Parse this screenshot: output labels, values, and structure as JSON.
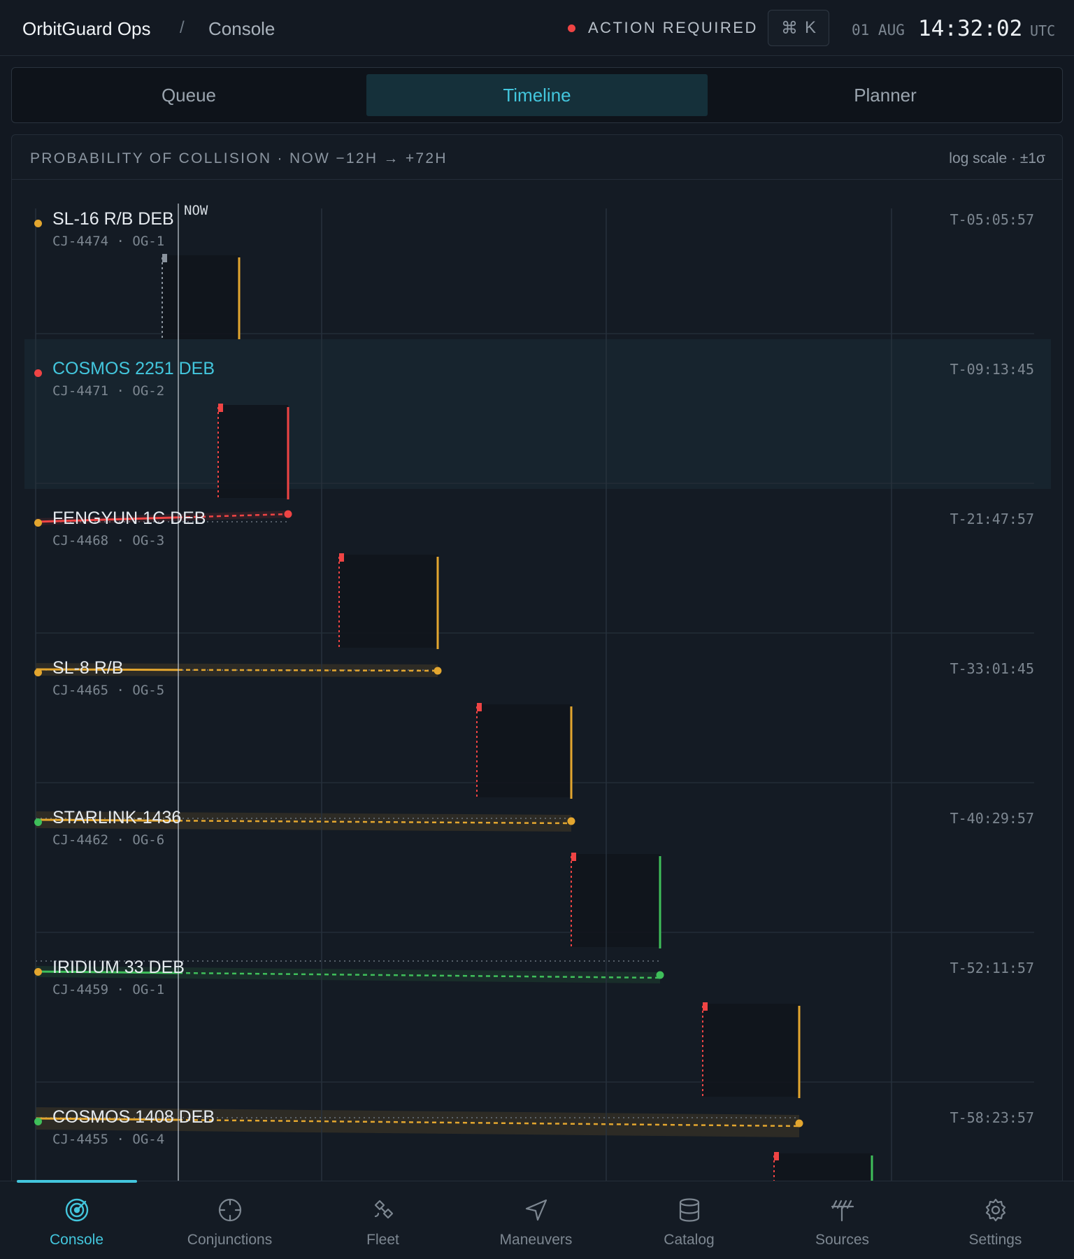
{
  "header": {
    "brand": "OrbitGuard Ops",
    "separator": "/",
    "breadcrumb": "Console",
    "alert_text": "ACTION REQUIRED",
    "shortcut_symbol": "⌘",
    "shortcut_key": "K",
    "date": "01 AUG",
    "time": "14:32:02",
    "timezone": "UTC"
  },
  "tabs": [
    {
      "label": "Queue",
      "active": false
    },
    {
      "label": "Timeline",
      "active": true
    },
    {
      "label": "Planner",
      "active": false
    }
  ],
  "panel": {
    "title": "PROBABILITY OF COLLISION · NOW −12H → +72H",
    "meta": "log scale · ±1σ",
    "now_label": "NOW"
  },
  "rows": [
    {
      "name": "SL-16 R/B DEB",
      "sub": "CJ-4474 · OG-1",
      "countdown": "T-05:05:57",
      "status": "caution",
      "highlight": false
    },
    {
      "name": "COSMOS 2251 DEB",
      "sub": "CJ-4471 · OG-2",
      "countdown": "T-09:13:45",
      "status": "critical",
      "highlight": true
    },
    {
      "name": "FENGYUN 1C DEB",
      "sub": "CJ-4468 · OG-3",
      "countdown": "T-21:47:57",
      "status": "caution",
      "highlight": false
    },
    {
      "name": "SL-8 R/B",
      "sub": "CJ-4465 · OG-5",
      "countdown": "T-33:01:45",
      "status": "caution",
      "highlight": false
    },
    {
      "name": "STARLINK-1436",
      "sub": "CJ-4462 · OG-6",
      "countdown": "T-40:29:57",
      "status": "nominal",
      "highlight": false
    },
    {
      "name": "IRIDIUM 33 DEB",
      "sub": "CJ-4459 · OG-1",
      "countdown": "T-52:11:57",
      "status": "caution",
      "highlight": false
    },
    {
      "name": "COSMOS 1408 DEB",
      "sub": "CJ-4455 · OG-4",
      "countdown": "T-58:23:57",
      "status": "nominal",
      "highlight": false
    }
  ],
  "colors": {
    "critical": "#ef4444",
    "caution": "#e3a62f",
    "nominal": "#3fbf5a",
    "accent": "#43c6dd"
  },
  "nav": [
    {
      "label": "Console",
      "icon": "radar-icon",
      "active": true
    },
    {
      "label": "Conjunctions",
      "icon": "crosshair-icon",
      "active": false
    },
    {
      "label": "Fleet",
      "icon": "satellite-icon",
      "active": false
    },
    {
      "label": "Maneuvers",
      "icon": "navigation-icon",
      "active": false
    },
    {
      "label": "Catalog",
      "icon": "database-icon",
      "active": false
    },
    {
      "label": "Sources",
      "icon": "antenna-icon",
      "active": false
    },
    {
      "label": "Settings",
      "icon": "gear-icon",
      "active": false
    }
  ]
}
